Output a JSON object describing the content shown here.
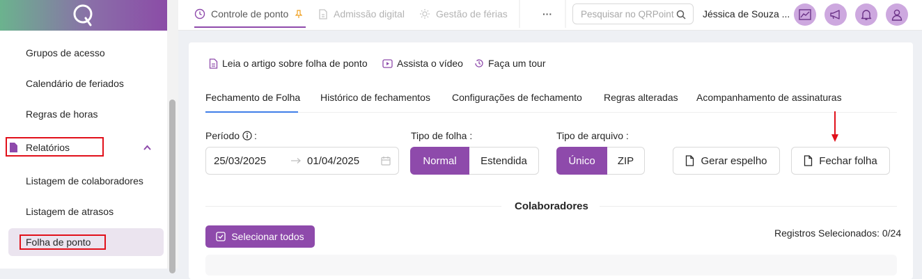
{
  "sidebar": {
    "items": [
      {
        "label": "Grupos de acesso"
      },
      {
        "label": "Calendário de feriados"
      },
      {
        "label": "Regras de horas"
      },
      {
        "label": "Relatórios"
      },
      {
        "label": "Listagem de colaboradores"
      },
      {
        "label": "Listagem de atrasos"
      },
      {
        "label": "Folha de ponto"
      }
    ]
  },
  "topbar": {
    "tabs": [
      {
        "label": "Controle de ponto"
      },
      {
        "label": "Admissão digital"
      },
      {
        "label": "Gestão de férias"
      }
    ],
    "more": "···",
    "search_placeholder": "Pesquisar no QRPoint",
    "user_name": "Jéssica de Souza ..."
  },
  "links": {
    "article": "Leia o artigo sobre folha de ponto",
    "video": "Assista o vídeo",
    "tour": "Faça um tour"
  },
  "subtabs": [
    {
      "label": "Fechamento de Folha"
    },
    {
      "label": "Histórico de fechamentos"
    },
    {
      "label": "Configurações de fechamento"
    },
    {
      "label": "Regras alteradas"
    },
    {
      "label": "Acompanhamento de assinaturas"
    }
  ],
  "form": {
    "period_label": "Período",
    "period_colon": ":",
    "start_date": "25/03/2025",
    "end_date": "01/04/2025",
    "sheet_type_label": "Tipo de folha :",
    "sheet_options": [
      "Normal",
      "Estendida"
    ],
    "sheet_selected": "Normal",
    "file_type_label": "Tipo de arquivo :",
    "file_options": [
      "Único",
      "ZIP"
    ],
    "file_selected": "Único",
    "generate_button": "Gerar espelho",
    "close_button": "Fechar folha"
  },
  "collaborators": {
    "title": "Colaboradores",
    "select_all": "Selecionar todos",
    "registers_selected": "Registros Selecionados: 0/24"
  },
  "colors": {
    "accent": "#8e4aab",
    "highlight_box": "#e1101a"
  }
}
